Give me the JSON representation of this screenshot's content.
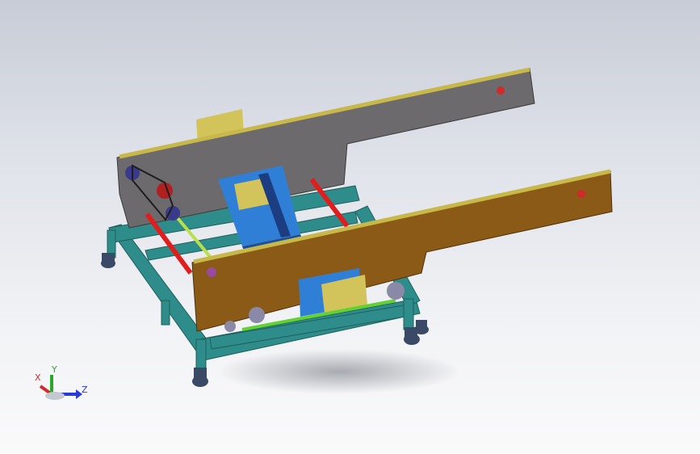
{
  "viewport": {
    "background_top": "#c8ccd6",
    "background_bottom": "#fafafb"
  },
  "model": {
    "colors": {
      "frame": "#2e8c8a",
      "frame_dark": "#1f5f5e",
      "back_plate": "#6d6a6d",
      "front_plate": "#8a5a16",
      "chain": "#c8b84a",
      "rod_red": "#e01e1e",
      "rod_green": "#62d232",
      "rod_yellowgreen": "#b8e04a",
      "carriage_blue": "#2f7fd6",
      "bracket_yellow": "#d2c35a",
      "caster": "#3a4a66"
    }
  },
  "triad": {
    "x_label": "X",
    "y_label": "Y",
    "z_label": "Z",
    "x_color": "#d42a2a",
    "y_color": "#2aa82a",
    "z_color": "#2a3ad4"
  }
}
